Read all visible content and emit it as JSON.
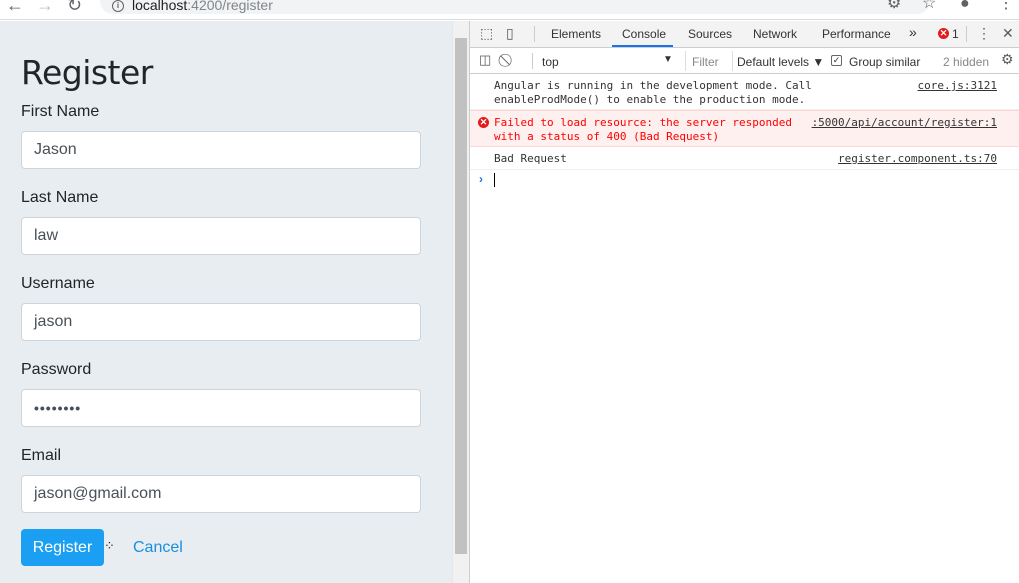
{
  "browser": {
    "url_host": "localhost",
    "url_rest": ":4200/register",
    "back_icon": "arrow-left",
    "forward_icon": "arrow-right",
    "reload_icon": "reload",
    "info_icon": "i"
  },
  "form": {
    "title": "Register",
    "fields": [
      {
        "label": "First Name",
        "value": "Jason"
      },
      {
        "label": "Last Name",
        "value": "law"
      },
      {
        "label": "Username",
        "value": "jason"
      },
      {
        "label": "Password",
        "value": "••••••••"
      },
      {
        "label": "Email",
        "value": "jason@gmail.com"
      }
    ],
    "register_label": "Register",
    "cancel_label": "Cancel"
  },
  "devtools": {
    "tabs": [
      "Elements",
      "Console",
      "Sources",
      "Network",
      "Performance"
    ],
    "active_tab": "Console",
    "more_tabs": "»",
    "error_count": "1",
    "context": "top",
    "filter_placeholder": "Filter",
    "levels": "Default levels ▼",
    "group_similar": "Group similar",
    "hidden_count": "2 hidden",
    "messages": [
      {
        "type": "log",
        "line1": "Angular is running in the development mode. Call",
        "line2": "enableProdMode() to enable the production mode.",
        "source": "core.js:3121"
      },
      {
        "type": "error",
        "line1": "Failed to load resource: the server responded",
        "line2": "with a status of 400 (Bad Request)",
        "source": ":5000/api/account/register:1"
      },
      {
        "type": "log",
        "line1": "Bad Request",
        "source": "register.component.ts:70"
      }
    ],
    "prompt": "›"
  },
  "colors": {
    "page_bg": "#e8edf2",
    "primary": "#1a9ff2",
    "link": "#1a8fe0",
    "error": "#ff0000"
  }
}
